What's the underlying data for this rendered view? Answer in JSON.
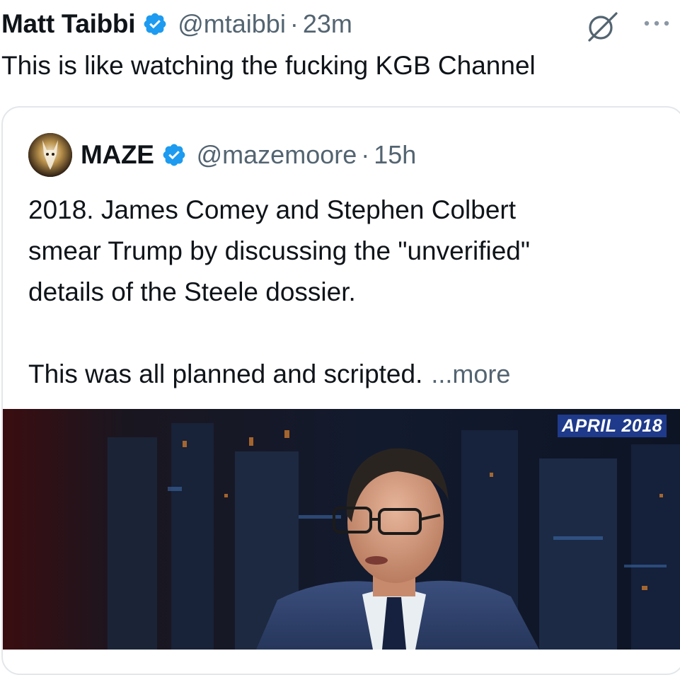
{
  "tweet": {
    "author_name": "Matt Taibbi",
    "author_handle": "@mtaibbi",
    "separator": "·",
    "time": "23m",
    "text": "This is like watching the fucking KGB Channel"
  },
  "quoted_tweet": {
    "author_name": "MAZE",
    "author_handle": "@mazemoore",
    "separator": "·",
    "time": "15h",
    "text_lines": [
      "2018. James Comey and Stephen Colbert",
      "smear Trump by discussing the \"unverified\"",
      "details of the Steele dossier.",
      "",
      "This was all planned and scripted."
    ],
    "more_label": "...more",
    "media": {
      "badge_text": "APRIL 2018"
    }
  },
  "icons": {
    "verified": "verified-badge-icon",
    "grok": "grok-slash-icon",
    "more": "more-dots-icon"
  },
  "colors": {
    "verified_blue": "#1d9bf0",
    "secondary_text": "#536471",
    "badge_bg": "#1f3a8a"
  }
}
